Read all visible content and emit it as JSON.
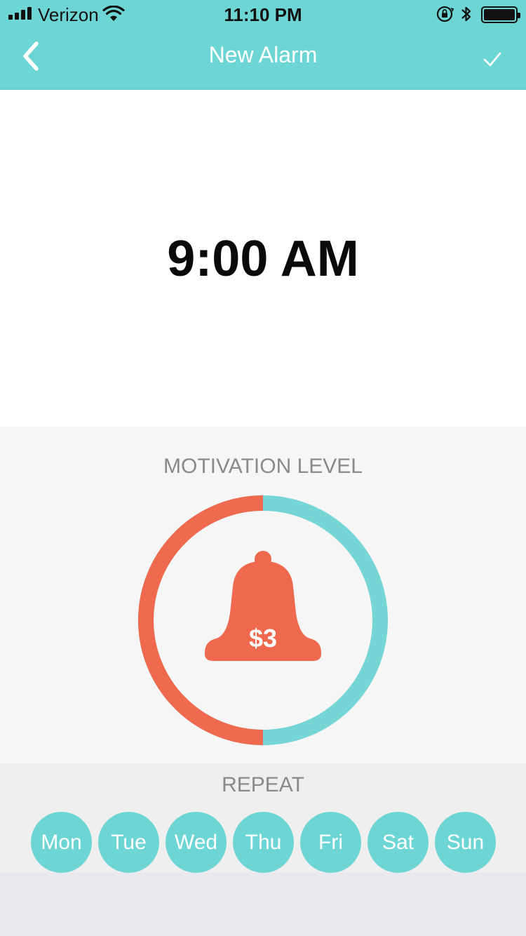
{
  "status_bar": {
    "carrier": "Verizon",
    "time": "11:10 PM",
    "signal_bars": 4,
    "battery_level": 1.0
  },
  "nav": {
    "title": "New Alarm",
    "back_icon": "chevron-left-icon",
    "done_icon": "checkmark-icon"
  },
  "alarm": {
    "time": "9:00 AM"
  },
  "motivation": {
    "label": "MOTIVATION LEVEL",
    "amount": "$3",
    "level_fraction": 0.5,
    "colors": {
      "filled": "#ef694e",
      "remaining": "#76d6d6"
    }
  },
  "repeat": {
    "label": "REPEAT",
    "days": [
      "Mon",
      "Tue",
      "Wed",
      "Thu",
      "Fri",
      "Sat",
      "Sun"
    ]
  },
  "colors": {
    "accent": "#6dd6d4",
    "bell": "#ef694e"
  }
}
